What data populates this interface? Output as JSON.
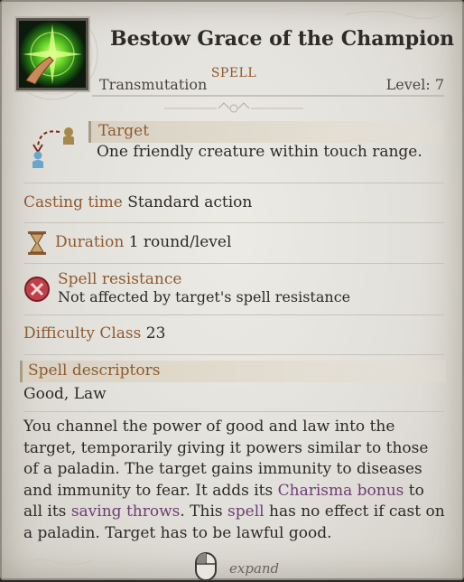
{
  "spell": {
    "title": "Bestow Grace of the Champion",
    "school": "Transmutation",
    "type_label": "SPELL",
    "level": "Level: 7"
  },
  "target": {
    "label": "Target",
    "value": "One friendly creature within touch range."
  },
  "casting_time": {
    "label": "Casting time",
    "value": "Standard action"
  },
  "duration": {
    "label": "Duration",
    "value": "1 round/level"
  },
  "spell_resistance": {
    "label": "Spell resistance",
    "value": "Not affected by target's spell resistance"
  },
  "difficulty": {
    "label": "Difficulty Class",
    "value": "23"
  },
  "descriptors": {
    "label": "Spell descriptors",
    "value": "Good, Law"
  },
  "description": {
    "p1": "You channel the power of good and law into the target, temporarily giving it powers similar to those of a paladin. The target gains immunity to diseases and immunity to fear. It adds its ",
    "kw1": "Charisma bonus",
    "p2": " to all its ",
    "kw2": "saving throws",
    "p3": ". This ",
    "kw3": "spell",
    "p4": " has no effect if cast on a paladin. Target has to be lawful good."
  },
  "footer": {
    "expand_label": "expand"
  },
  "colors": {
    "accent_orange": "#8e5a2f",
    "keyword_purple": "#6e3c77",
    "text_dark": "#2e2a27"
  }
}
